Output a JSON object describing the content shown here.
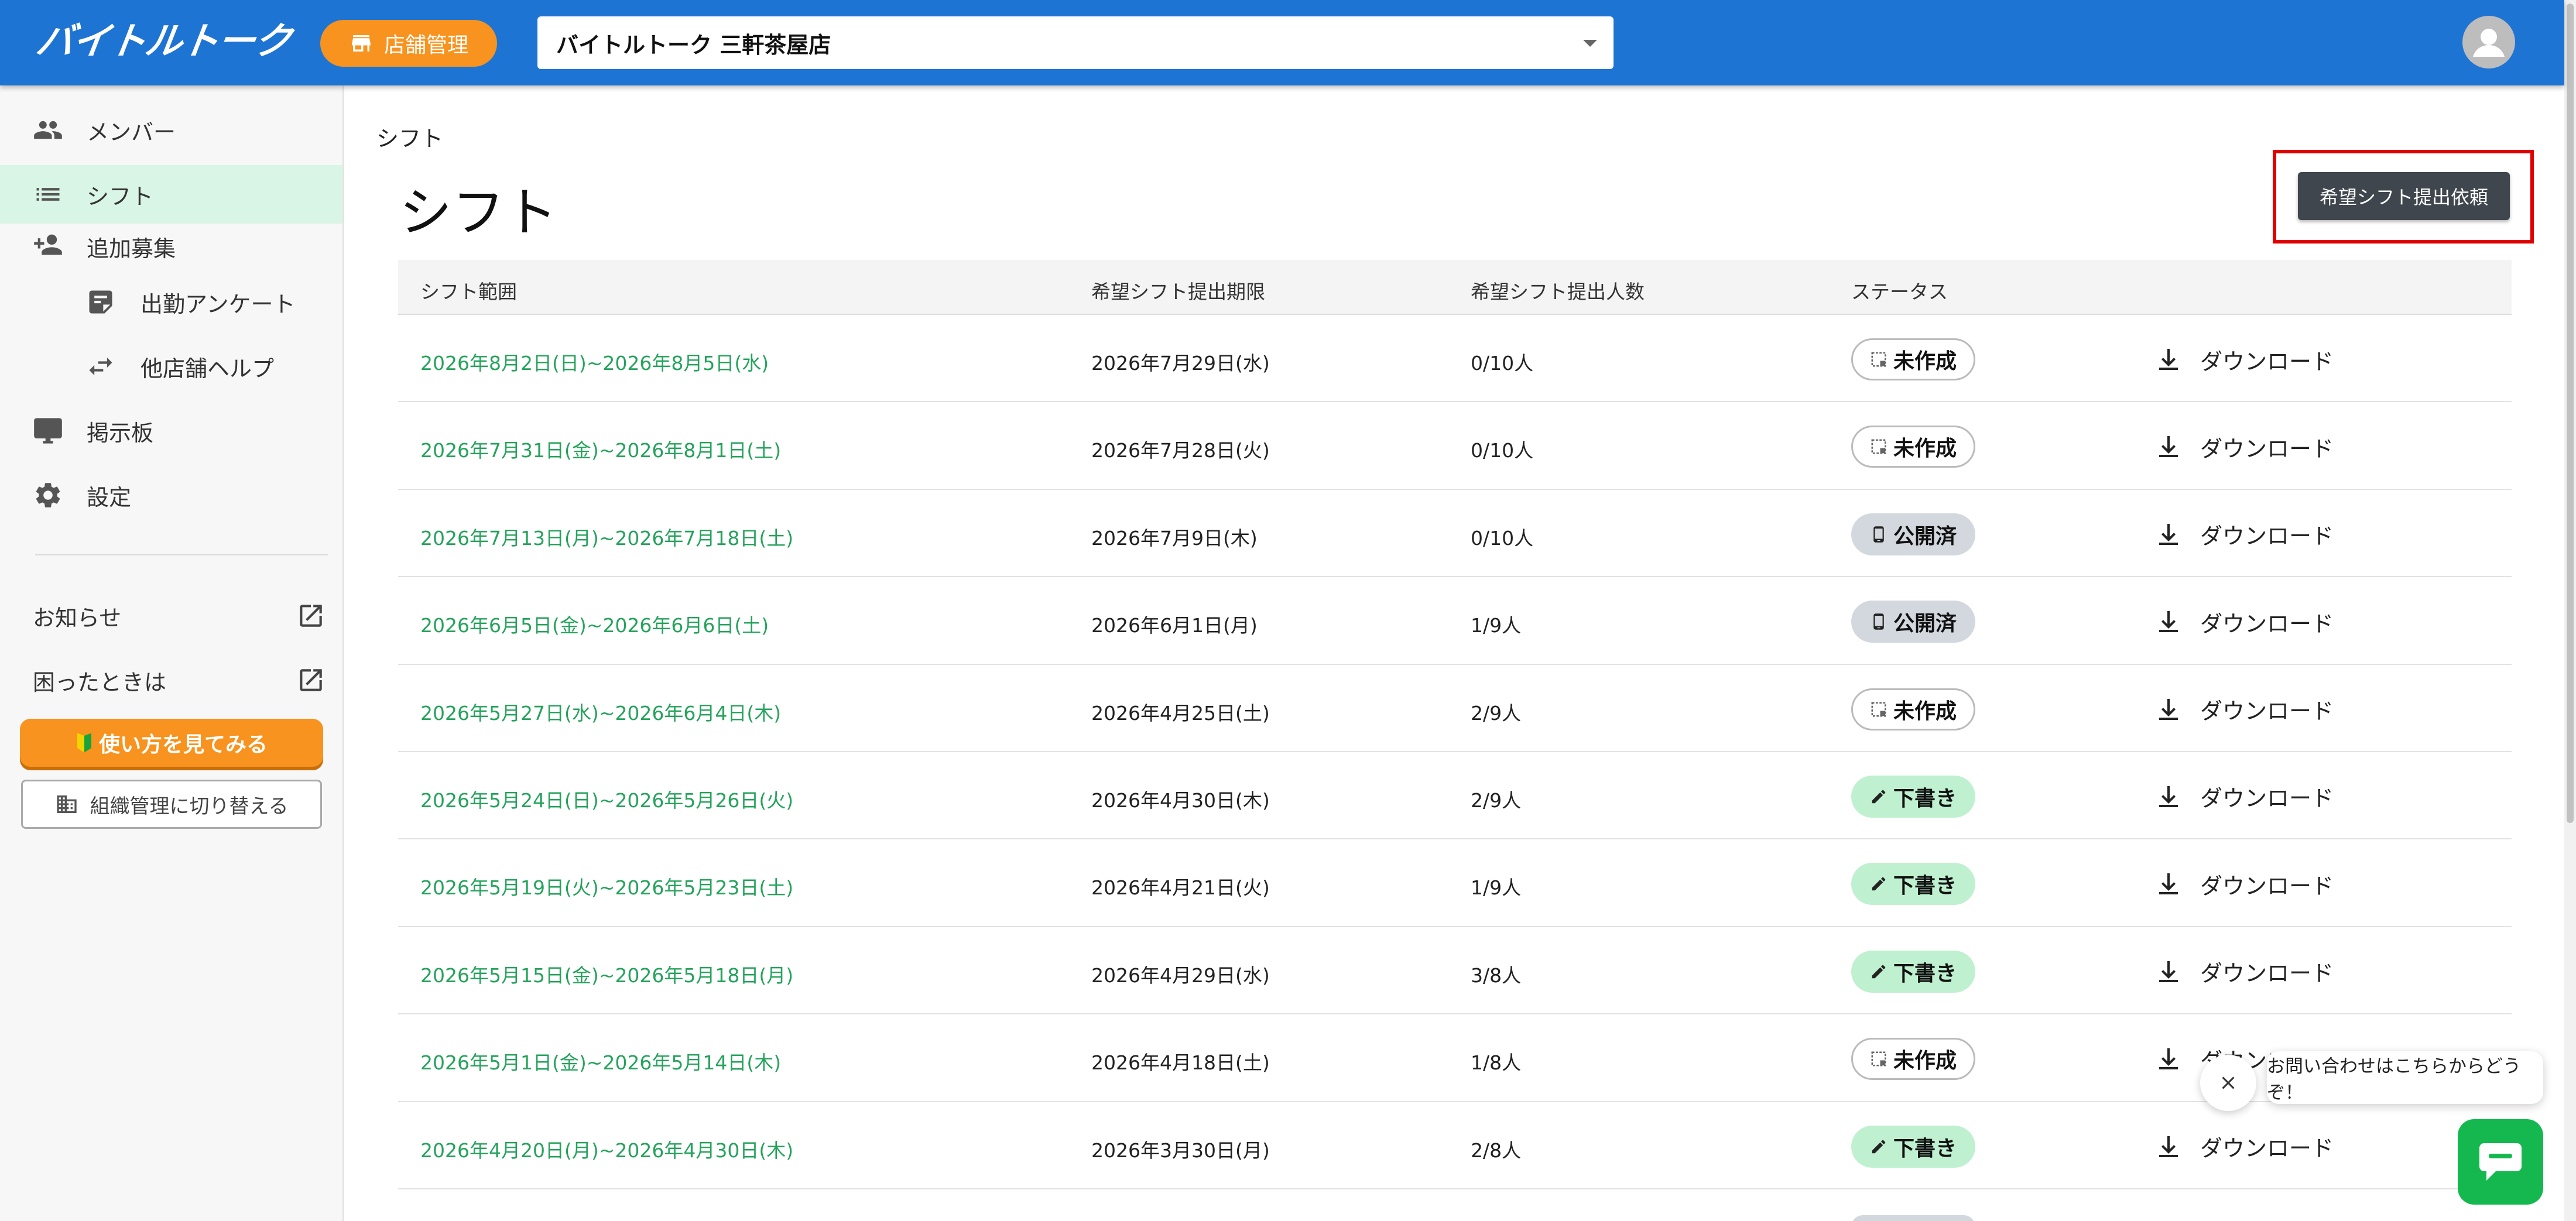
{
  "header": {
    "logo": "バイトルトーク",
    "store_button": "店舗管理",
    "store_selected": "バイトルトーク 三軒茶屋店"
  },
  "sidebar": {
    "items": [
      {
        "label": "メンバー",
        "icon": "people-icon"
      },
      {
        "label": "シフト",
        "icon": "list-icon",
        "active": true
      },
      {
        "label": "追加募集",
        "icon": "person-add-icon"
      },
      {
        "label": "出勤アンケート",
        "icon": "note-icon",
        "sub": true
      },
      {
        "label": "他店舗ヘルプ",
        "icon": "swap-icon",
        "sub": true
      },
      {
        "label": "掲示板",
        "icon": "monitor-icon"
      },
      {
        "label": "設定",
        "icon": "gear-icon"
      }
    ],
    "links": [
      {
        "label": "お知らせ",
        "icon": "open-in-new-icon"
      },
      {
        "label": "困ったときは",
        "icon": "open-in-new-icon"
      }
    ],
    "howto_button": "使い方を見てみる",
    "switch_button": "組織管理に切り替える"
  },
  "main": {
    "breadcrumb": "シフト",
    "title": "シフト",
    "request_button": "希望シフト提出依頼",
    "columns": [
      "シフト範囲",
      "希望シフト提出期限",
      "希望シフト提出人数",
      "ステータス"
    ],
    "download_label": "ダウンロード",
    "rows": [
      {
        "range": "2026年8月2日(日)~2026年8月5日(水)",
        "deadline": "2026年7月29日(水)",
        "count": "0/10人",
        "status": "未作成",
        "status_type": "uncreated"
      },
      {
        "range": "2026年7月31日(金)~2026年8月1日(土)",
        "deadline": "2026年7月28日(火)",
        "count": "0/10人",
        "status": "未作成",
        "status_type": "uncreated"
      },
      {
        "range": "2026年7月13日(月)~2026年7月18日(土)",
        "deadline": "2026年7月9日(木)",
        "count": "0/10人",
        "status": "公開済",
        "status_type": "published"
      },
      {
        "range": "2026年6月5日(金)~2026年6月6日(土)",
        "deadline": "2026年6月1日(月)",
        "count": "1/9人",
        "status": "公開済",
        "status_type": "published"
      },
      {
        "range": "2026年5月27日(水)~2026年6月4日(木)",
        "deadline": "2026年4月25日(土)",
        "count": "2/9人",
        "status": "未作成",
        "status_type": "uncreated"
      },
      {
        "range": "2026年5月24日(日)~2026年5月26日(火)",
        "deadline": "2026年4月30日(木)",
        "count": "2/9人",
        "status": "下書き",
        "status_type": "draft"
      },
      {
        "range": "2026年5月19日(火)~2026年5月23日(土)",
        "deadline": "2026年4月21日(火)",
        "count": "1/9人",
        "status": "下書き",
        "status_type": "draft"
      },
      {
        "range": "2026年5月15日(金)~2026年5月18日(月)",
        "deadline": "2026年4月29日(水)",
        "count": "3/8人",
        "status": "下書き",
        "status_type": "draft"
      },
      {
        "range": "2026年5月1日(金)~2026年5月14日(木)",
        "deadline": "2026年4月18日(土)",
        "count": "1/8人",
        "status": "未作成",
        "status_type": "uncreated"
      },
      {
        "range": "2026年4月20日(月)~2026年4月30日(木)",
        "deadline": "2026年3月30日(月)",
        "count": "2/8人",
        "status": "下書き",
        "status_type": "draft"
      }
    ]
  },
  "chat": {
    "message": "お問い合わせはこちらからどうぞ！"
  },
  "colors": {
    "header": "#1e74d3",
    "accent_orange": "#f7931e",
    "link_green": "#25a35c",
    "highlight_red": "#e00000",
    "chat_green": "#14b84f"
  }
}
